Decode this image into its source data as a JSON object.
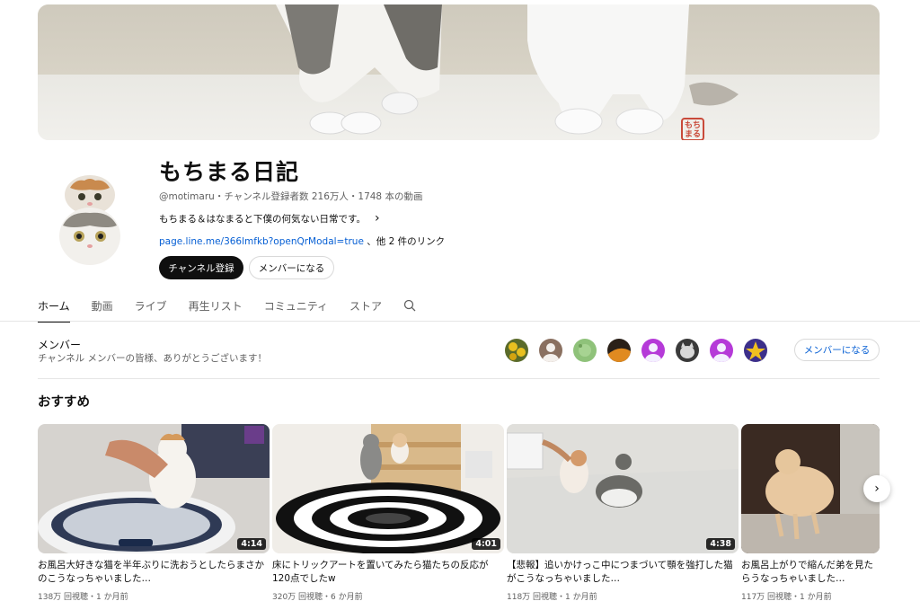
{
  "channel": {
    "name": "もちまる日記",
    "meta": "@motimaru・チャンネル登録者数 216万人・1748 本の動画",
    "description": "もちまる＆はなまると下僕の何気ない日常です。",
    "link_url": "page.line.me/366lmfkb?openQrModal=true",
    "link_more": "、他 2 件のリンク",
    "subscribe_label": "チャンネル登録",
    "member_label": "メンバーになる"
  },
  "tabs": [
    {
      "label": "ホーム",
      "active": true
    },
    {
      "label": "動画"
    },
    {
      "label": "ライブ"
    },
    {
      "label": "再生リスト"
    },
    {
      "label": "コミュニティ"
    },
    {
      "label": "ストア"
    }
  ],
  "members": {
    "title": "メンバー",
    "subtitle": "チャンネル メンバーの皆様、ありがとうございます！",
    "button_label": "メンバーになる",
    "avatar_colors": [
      "#c9a227",
      "#8a7060",
      "#8fc27a",
      "#2a2018",
      "#b53ad8",
      "#3a3a3a",
      "#b53ad8",
      "#3c2f8a"
    ]
  },
  "recommended": {
    "title": "おすすめ",
    "videos": [
      {
        "title": "お風呂大好きな猫を半年ぶりに洗おうとしたらまさかのこうなっちゃいました…",
        "meta": "138万 回視聴・1 か月前",
        "duration": "4:14"
      },
      {
        "title": "床にトリックアートを置いてみたら猫たちの反応が120点でしたw",
        "meta": "320万 回視聴・6 か月前",
        "duration": "4:01"
      },
      {
        "title": "【悲報】追いかけっこ中につまづいて顎を強打した猫がこうなっちゃいました…",
        "meta": "118万 回視聴・1 か月前",
        "duration": "4:38"
      },
      {
        "title": "お風呂上がりで縮んだ弟を見たらうなっちゃいました…",
        "meta": "117万 回視聴・1 か月前",
        "duration": ""
      }
    ]
  },
  "banner_stamp": "もち まる",
  "accent": "#065fd4"
}
